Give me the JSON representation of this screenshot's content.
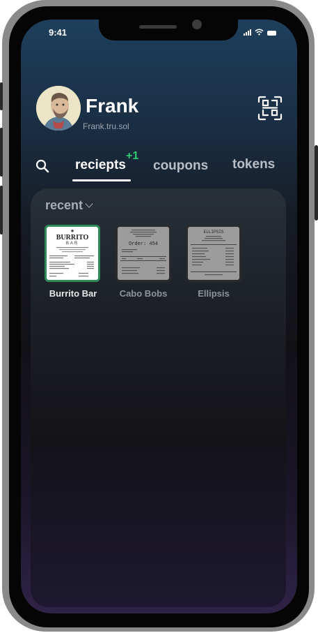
{
  "status_bar": {
    "time": "9:41"
  },
  "profile": {
    "name": "Frank",
    "handle": "Frank.tru.sol"
  },
  "tabs": [
    {
      "label": "reciepts",
      "active": true,
      "badge": "+1"
    },
    {
      "label": "coupons",
      "active": false
    },
    {
      "label": "tokens",
      "active": false
    }
  ],
  "section": {
    "title": "recent"
  },
  "receipts": [
    {
      "label": "Burrito Bar",
      "highlighted": true,
      "header": "BURRITO",
      "subheader": "BAR",
      "label_color": "#e6e6e6",
      "border_color": "#2e8b57"
    },
    {
      "label": "Cabo Bobs",
      "highlighted": false,
      "header": "Order: 454",
      "label_color": "#8f949a",
      "border_color": "#3a3a3a"
    },
    {
      "label": "Ellipsis",
      "highlighted": false,
      "header": "ELLIPSIS",
      "label_color": "#8f949a",
      "border_color": "#3a3a3a"
    }
  ],
  "colors": {
    "accent_green": "#2ecc71",
    "text_primary": "#ffffff",
    "text_secondary": "#b9bec6"
  }
}
